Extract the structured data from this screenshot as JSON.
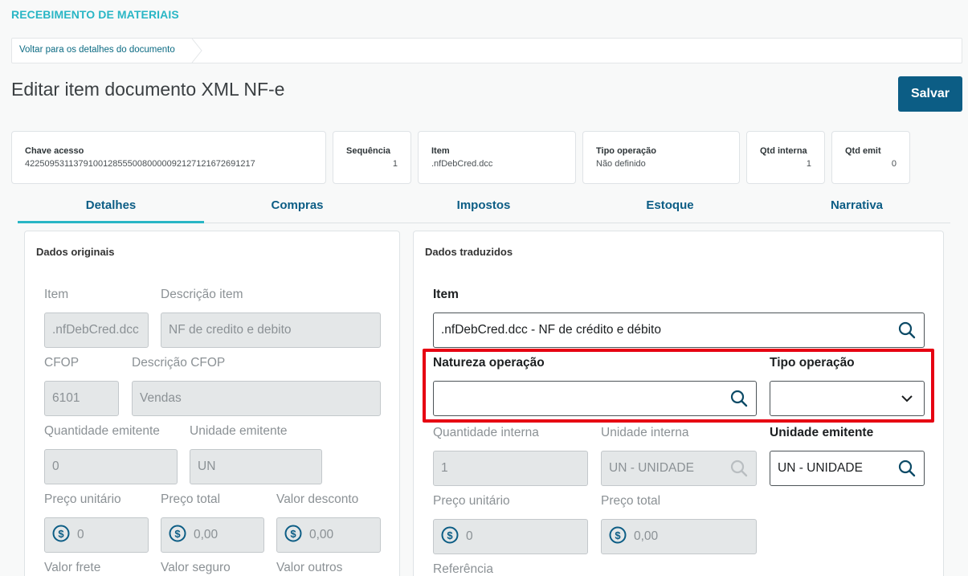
{
  "app": {
    "title": "RECEBIMENTO DE MATERIAIS"
  },
  "breadcrumb": {
    "back_label": "Voltar para os detalhes do documento"
  },
  "page": {
    "title": "Editar item documento XML NF-e",
    "save_label": "Salvar"
  },
  "info": {
    "chave": {
      "label": "Chave acesso",
      "value": "42250953113791001285550080000092127121672691217"
    },
    "sequencia": {
      "label": "Sequência",
      "value": "1"
    },
    "item": {
      "label": "Item",
      "value": ".nfDebCred.dcc"
    },
    "tipo_operacao": {
      "label": "Tipo operação",
      "value": "Não definido"
    },
    "qtd_interna": {
      "label": "Qtd interna",
      "value": "1"
    },
    "qtd_emit": {
      "label": "Qtd emit",
      "value": "0"
    }
  },
  "tabs": [
    {
      "label": "Detalhes",
      "active": true
    },
    {
      "label": "Compras"
    },
    {
      "label": "Impostos"
    },
    {
      "label": "Estoque"
    },
    {
      "label": "Narrativa"
    }
  ],
  "original": {
    "title": "Dados originais",
    "item": {
      "label": "Item",
      "value": ".nfDebCred.dcc"
    },
    "descricao_item": {
      "label": "Descrição item",
      "value": "NF de credito e debito"
    },
    "cfop": {
      "label": "CFOP",
      "value": "6101"
    },
    "descricao_cfop": {
      "label": "Descrição CFOP",
      "value": "Vendas"
    },
    "qtd_emitente": {
      "label": "Quantidade emitente",
      "value": "0"
    },
    "unidade_emitente": {
      "label": "Unidade emitente",
      "value": "UN"
    },
    "preco_unitario": {
      "label": "Preço unitário",
      "value": "0"
    },
    "preco_total": {
      "label": "Preço total",
      "value": "0,00"
    },
    "valor_desconto": {
      "label": "Valor desconto",
      "value": "0,00"
    },
    "valor_frete": {
      "label": "Valor frete"
    },
    "valor_seguro": {
      "label": "Valor seguro"
    },
    "valor_outros": {
      "label": "Valor outros"
    }
  },
  "translated": {
    "title": "Dados traduzidos",
    "item": {
      "label": "Item",
      "value": ".nfDebCred.dcc - NF de crédito e débito"
    },
    "natureza_operacao": {
      "label": "Natureza operação",
      "value": ""
    },
    "tipo_operacao": {
      "label": "Tipo operação",
      "value": ""
    },
    "qtd_interna": {
      "label": "Quantidade interna",
      "value": "1"
    },
    "unidade_interna": {
      "label": "Unidade interna",
      "value": "UN - UNIDADE"
    },
    "unidade_emitente": {
      "label": "Unidade emitente",
      "value": "UN - UNIDADE"
    },
    "preco_unitario": {
      "label": "Preço unitário",
      "value": "0"
    },
    "preco_total": {
      "label": "Preço total",
      "value": "0,00"
    },
    "referencia": {
      "label": "Referência"
    }
  },
  "colors": {
    "accent": "#29b6c5",
    "primary": "#0c5d85",
    "highlight": "#e60012"
  }
}
